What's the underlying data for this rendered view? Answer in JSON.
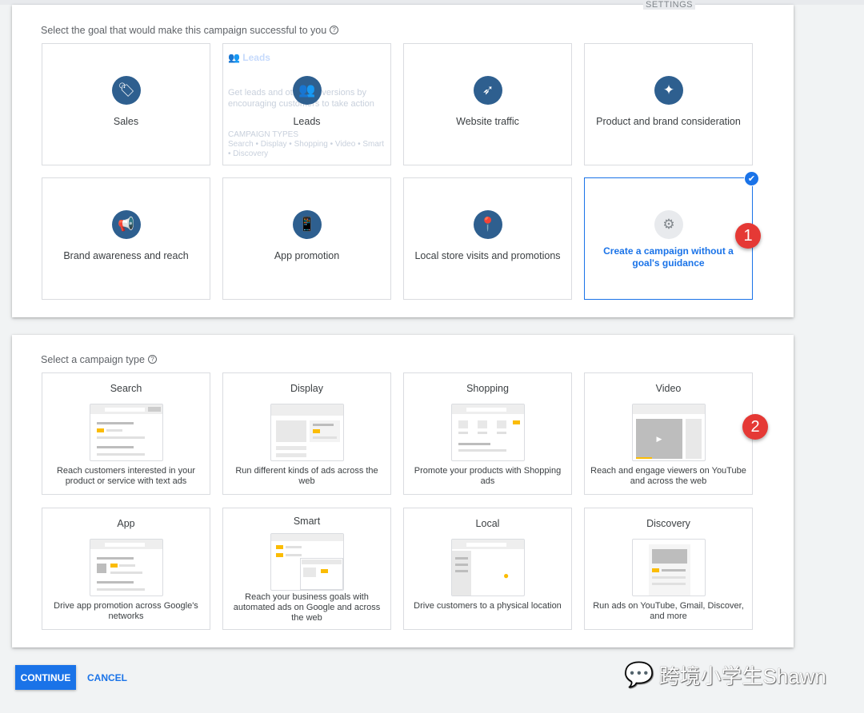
{
  "header": {
    "settings_label": "SETTINGS"
  },
  "goal_section": {
    "title": "Select the goal that would make this campaign successful to you",
    "goals": [
      {
        "label": "Sales",
        "icon": "tag-icon"
      },
      {
        "label": "Leads",
        "icon": "people-icon"
      },
      {
        "label": "Website traffic",
        "icon": "cursor-click-icon"
      },
      {
        "label": "Product and brand consideration",
        "icon": "sparkle-icon"
      },
      {
        "label": "Brand awareness and reach",
        "icon": "megaphone-icon"
      },
      {
        "label": "App promotion",
        "icon": "phone-icon"
      },
      {
        "label": "Local store visits and promotions",
        "icon": "location-pin-icon"
      },
      {
        "label": "Create a campaign without a goal's guidance",
        "icon": "gear-icon",
        "selected": true
      }
    ],
    "leads_hover": {
      "title": "Leads",
      "description": "Get leads and other conversions by encouraging customers to take action",
      "types_label": "CAMPAIGN TYPES",
      "types": "Search • Display • Shopping • Video • Smart • Discovery"
    }
  },
  "type_section": {
    "title": "Select a campaign type",
    "types": [
      {
        "title": "Search",
        "description": "Reach customers interested in your product or service with text ads"
      },
      {
        "title": "Display",
        "description": "Run different kinds of ads across the web"
      },
      {
        "title": "Shopping",
        "description": "Promote your products with Shopping ads"
      },
      {
        "title": "Video",
        "description": "Reach and engage viewers on YouTube and across the web"
      },
      {
        "title": "App",
        "description": "Drive app promotion across Google's networks"
      },
      {
        "title": "Smart",
        "description": "Reach your business goals with automated ads on Google and across the web"
      },
      {
        "title": "Local",
        "description": "Drive customers to a physical location"
      },
      {
        "title": "Discovery",
        "description": "Run ads on YouTube, Gmail, Discover, and more"
      }
    ]
  },
  "annotations": {
    "one": "1",
    "two": "2"
  },
  "actions": {
    "continue": "CONTINUE",
    "cancel": "CANCEL"
  },
  "watermark": "跨境小学生Shawn",
  "colors": {
    "accent": "#1a73e8",
    "icon_bg": "#2e5f8f",
    "badge": "#e53935"
  }
}
